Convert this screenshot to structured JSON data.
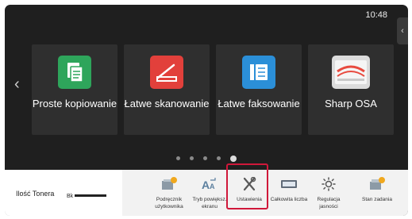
{
  "status": {
    "time": "10:48"
  },
  "home": {
    "tiles": [
      {
        "label": "Proste kopiowanie",
        "icon": "copy-icon",
        "color": "#2ea55b"
      },
      {
        "label": "Łatwe skanowanie",
        "icon": "scan-icon",
        "color": "#e2403b"
      },
      {
        "label": "Łatwe faksowanie",
        "icon": "fax-icon",
        "color": "#2b8fd8"
      },
      {
        "label": "Sharp OSA",
        "icon": "sharp-osa-icon",
        "color": "#e84a3f"
      }
    ],
    "page_count": 5,
    "active_page": 5
  },
  "taskbar": {
    "toner": {
      "label": "Ilość Tonera",
      "color_label": "Bk"
    },
    "items": [
      {
        "label": "Podręcznik użytkownika",
        "icon": "user-manual-icon"
      },
      {
        "label": "Tryb powiększ. ekranu",
        "icon": "enlarge-display-icon"
      },
      {
        "label": "Ustawienia",
        "icon": "settings-icon",
        "selected": true
      },
      {
        "label": "Całkowita liczba",
        "icon": "total-count-icon"
      },
      {
        "label": "Regulacja jasności",
        "icon": "brightness-icon"
      },
      {
        "label": "Stan zadania",
        "icon": "job-status-icon"
      }
    ]
  }
}
